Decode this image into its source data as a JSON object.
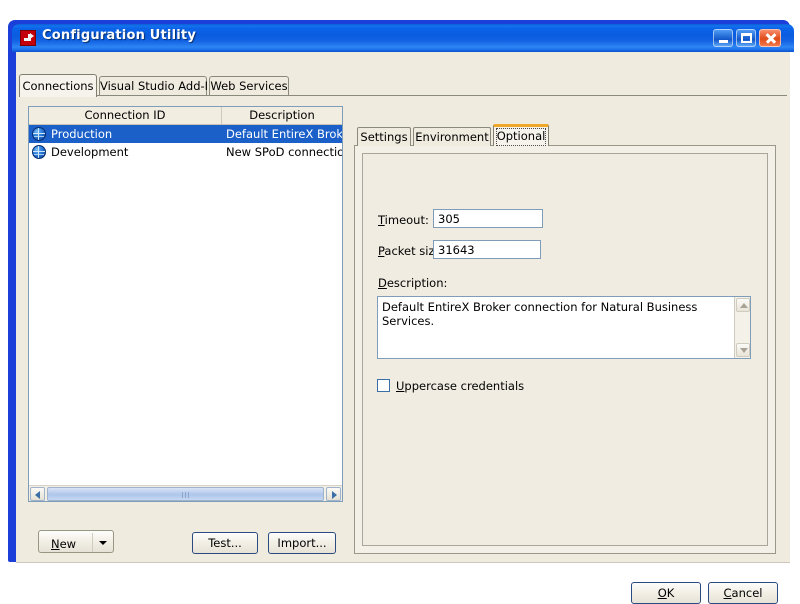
{
  "window": {
    "title": "Configuration Utility",
    "icon": "config-utility-icon",
    "minimize_label": "",
    "maximize_label": "",
    "close_label": ""
  },
  "outer_tabs": [
    {
      "label": "Connections",
      "active": true
    },
    {
      "label": "Visual Studio Add-In",
      "active": false
    },
    {
      "label": "Web Services",
      "active": false
    }
  ],
  "list": {
    "columns": [
      "Connection ID",
      "Description"
    ],
    "rows": [
      {
        "icon": "globe-icon",
        "id": "Production",
        "description": "Default EntireX Broker",
        "selected": true
      },
      {
        "icon": "globe-icon",
        "id": "Development",
        "description": "New SPoD connection",
        "selected": false
      }
    ]
  },
  "left_buttons": {
    "new_label": "New",
    "new_accelerator": "N",
    "new_dropdown": "chevron-down-icon",
    "test_label": "Test...",
    "import_label": "Import..."
  },
  "inner_tabs": [
    {
      "label": "Settings",
      "active": false
    },
    {
      "label": "Environment",
      "active": false
    },
    {
      "label": "Optional",
      "active": true
    }
  ],
  "optional_panel": {
    "timeout_label": "Timeout:",
    "timeout_accelerator": "T",
    "timeout_label_rest": "imeout:",
    "timeout_value": "305",
    "packet_label_accelerator": "P",
    "packet_label_rest": "acket size:",
    "packet_value": "31643",
    "description_label_accelerator": "D",
    "description_label_rest": "escription:",
    "description_value": "Default EntireX Broker connection for Natural Business Services.",
    "uppercase_accelerator": "U",
    "uppercase_label_rest": "ppercase credentials",
    "uppercase_checked": false
  },
  "footer": {
    "ok_label": "OK",
    "ok_accelerator": "O",
    "ok_label_rest": "K",
    "cancel_label": "Cancel",
    "cancel_accelerator": "C",
    "cancel_label_rest": "ancel"
  },
  "colors": {
    "title_bar_blue": "#0a5ce0",
    "selection_blue": "#1b60c8",
    "active_tab_accent": "#f0a828",
    "dialog_face": "#efebdf"
  }
}
